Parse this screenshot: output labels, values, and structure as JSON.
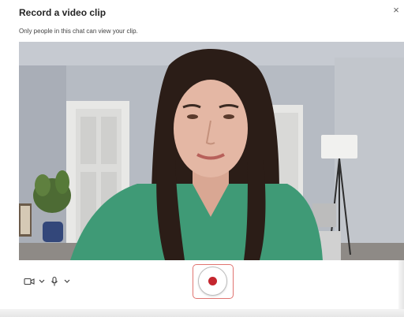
{
  "dialog": {
    "title": "Record a video clip",
    "close_label": "×",
    "subtitle": "Only people in this chat can view your clip."
  },
  "controls": {
    "camera_icon": "video-camera-icon",
    "camera_menu_icon": "chevron-down-icon",
    "mic_icon": "microphone-icon",
    "mic_menu_icon": "chevron-down-icon",
    "record_icon": "record-dot-icon"
  },
  "colors": {
    "record_red": "#c4262e",
    "record_outline": "#e07470",
    "shirt_green": "#3f9a76"
  }
}
